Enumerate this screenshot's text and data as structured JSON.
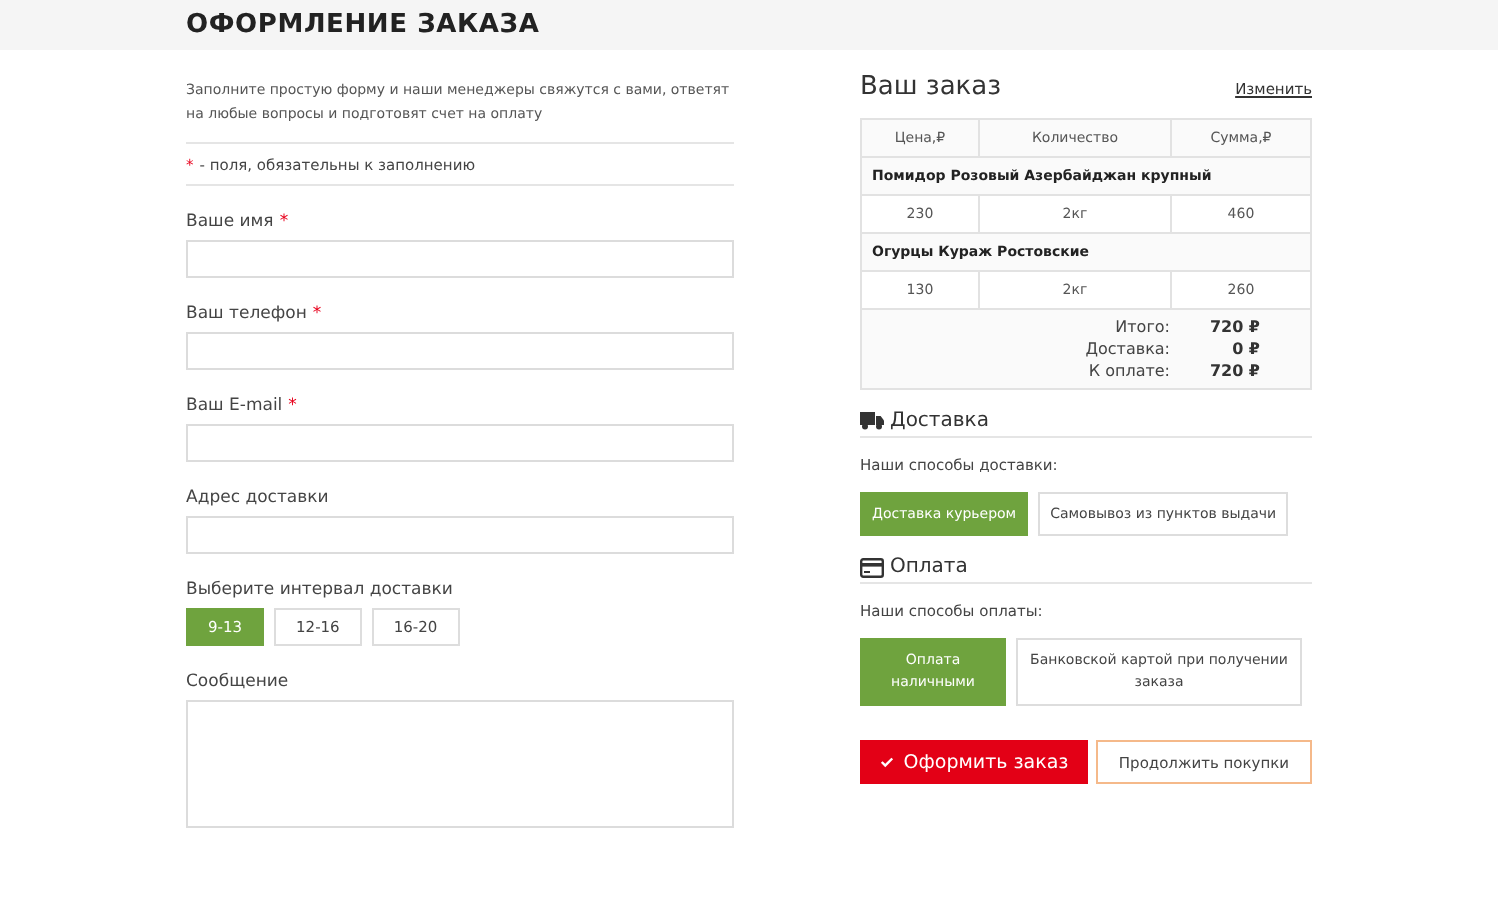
{
  "header": {
    "title": "ОФОРМЛЕНИЕ ЗАКАЗА"
  },
  "form": {
    "intro": "Заполните простую форму и наши менеджеры свяжутся с вами, ответят на любые вопросы и подготовят счет на оплату",
    "required_mark": "*",
    "required_note": "- поля, обязательны к заполнению",
    "fields": [
      {
        "kind": "input",
        "label": "Ваше имя",
        "required": true
      },
      {
        "kind": "input",
        "label": "Ваш телефон",
        "required": true
      },
      {
        "kind": "input",
        "label": "Ваш E-mail",
        "required": true
      },
      {
        "kind": "input",
        "label": "Адрес доставки",
        "required": false
      },
      {
        "kind": "choice",
        "label": "Выберите интервал доставки",
        "options": [
          {
            "label": "9-13",
            "selected": true
          },
          {
            "label": "12-16",
            "selected": false
          },
          {
            "label": "16-20",
            "selected": false
          }
        ]
      },
      {
        "kind": "textarea",
        "label": "Сообщение",
        "required": false
      }
    ]
  },
  "order": {
    "title": "Ваш заказ",
    "edit_link": "Изменить",
    "columns": [
      "Цена,₽",
      "Количество",
      "Сумма,₽"
    ],
    "items": [
      {
        "name": "Помидор Розовый Азербайджан крупный",
        "cells": [
          "230",
          "2кг",
          "460"
        ]
      },
      {
        "name": "Огурцы Кураж Ростовские",
        "cells": [
          "130",
          "2кг",
          "260"
        ]
      }
    ],
    "totals": [
      {
        "label": "Итого:",
        "value": "720 ₽"
      },
      {
        "label": "Доставка:",
        "value": "0 ₽"
      },
      {
        "label": "К оплате:",
        "value": "720 ₽"
      }
    ]
  },
  "sections": [
    {
      "kind": "delivery",
      "title": "Доставка",
      "subtitle": "Наши способы доставки:",
      "options": [
        {
          "label": "Доставка курьером",
          "selected": true
        },
        {
          "label": "Самовывоз из пунктов выдачи",
          "selected": false
        }
      ]
    },
    {
      "kind": "payment",
      "title": "Оплата",
      "subtitle": "Наши способы оплаты:",
      "options": [
        {
          "label": "Оплата наличными",
          "selected": true
        },
        {
          "label": "Банковской картой при получении заказа",
          "selected": false
        }
      ]
    }
  ],
  "actions": {
    "submit": "Оформить заказ",
    "continue": "Продолжить покупки"
  }
}
